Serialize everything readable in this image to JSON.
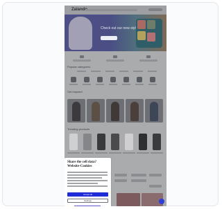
{
  "page": {
    "background": "#ffffff",
    "card_border": "#e3e6ea"
  },
  "site": {
    "logo": "Zalando",
    "hero_title": "Check out our new styles",
    "colors": {
      "hero": "#4b4e84",
      "accent": "#1f2bd6"
    }
  },
  "sections": {
    "categories_title": "Popular categories",
    "looks_title": "Get inspired",
    "products_title": "Trending products"
  },
  "cookie_banner": {
    "title": "Share the cell data? Website-Cookies",
    "primary_button": "Accept all",
    "secondary_button": "Settings",
    "icon": "help-icon"
  }
}
